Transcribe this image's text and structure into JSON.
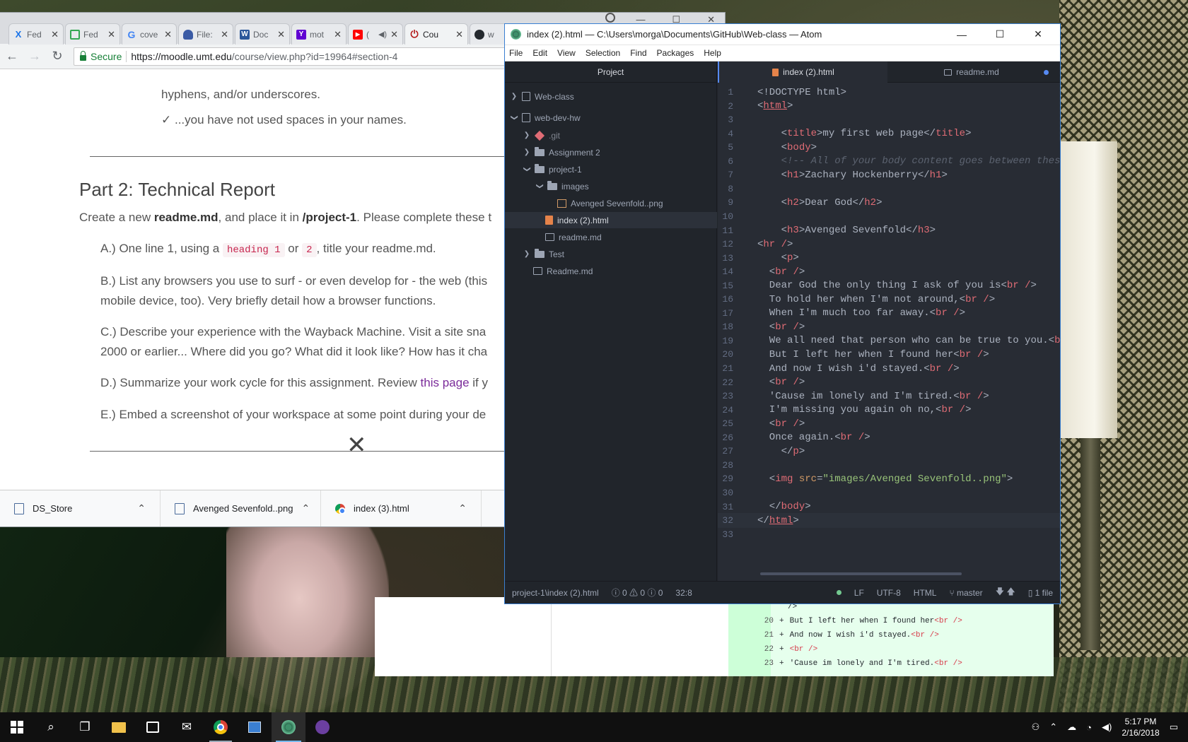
{
  "chrome": {
    "tabs": [
      {
        "label": "Fed",
        "icon": "x-logo-icon",
        "color": "#1a73e8"
      },
      {
        "label": "Fed",
        "icon": "document-icon",
        "color": "#34a853"
      },
      {
        "label": "cove",
        "icon": "google-icon",
        "color": "#4285f4"
      },
      {
        "label": "File:",
        "icon": "cloud-icon",
        "color": "#3b5ba5"
      },
      {
        "label": "Doc",
        "icon": "word-icon",
        "color": "#2b579a"
      },
      {
        "label": "mot",
        "icon": "yahoo-icon",
        "color": "#6001d2"
      },
      {
        "label": "(",
        "icon": "youtube-icon",
        "color": "#ff0000"
      },
      {
        "label": "Cou",
        "icon": "power-icon",
        "color": "#b31b1b"
      },
      {
        "label": "w",
        "icon": "github-icon",
        "color": "#24292e"
      }
    ],
    "url": {
      "secure": "Secure",
      "main": "https://moodle.umt.edu",
      "path": "/course/view.php?id=19964#section-4"
    },
    "page": {
      "line1": "hyphens, and/or underscores.",
      "line2": "✓ ...you have not used spaces in your names.",
      "heading": "Part 2: Technical Report",
      "intro_a": "Create a new ",
      "intro_b": "readme.md",
      "intro_c": ", and place it in ",
      "intro_d": "/project-1",
      "intro_e": ". Please complete these t",
      "a_pre": "A.) One line 1, using a ",
      "a_code1": "heading 1",
      "a_or": " or ",
      "a_code2": "2",
      "a_post": ", title your readme.md.",
      "b1": "B.) List any browsers you use to surf - or even develop for - the web (this",
      "b2": "mobile device, too). Very briefly detail how a browser functions.",
      "c1": "C.) Describe your experience with the Wayback Machine. Visit a site sna",
      "c2": "2000 or earlier... Where did you go? What did it look like? How has it cha",
      "d_pre": "D.) Summarize your work cycle for this assignment. Review ",
      "d_link": "this page",
      "d_post": " if y",
      "e": "E.) Embed a screenshot of your workspace at some point during your de"
    },
    "downloads": [
      {
        "name": "DS_Store"
      },
      {
        "name": "Avenged Sevenfold..png"
      },
      {
        "name": "index (3).html"
      }
    ]
  },
  "diff": {
    "rows": [
      {
        "num": "",
        "text": "/>"
      },
      {
        "num": "20",
        "text": "But I left her when I found her",
        "tag": "<br />"
      },
      {
        "num": "21",
        "text": "And now I wish i'd stayed.",
        "tag": "<br />"
      },
      {
        "num": "22",
        "text": "",
        "tag": "<br />"
      },
      {
        "num": "23",
        "text": "'Cause im lonely and I'm tired.",
        "tag": "<br />"
      }
    ]
  },
  "atom": {
    "title": "index (2).html — C:\\Users\\morga\\Documents\\GitHub\\Web-class — Atom",
    "menu": [
      "File",
      "Edit",
      "View",
      "Selection",
      "Find",
      "Packages",
      "Help"
    ],
    "tree_header": "Project",
    "tree": [
      {
        "label": "Web-class"
      },
      {
        "label": "web-dev-hw"
      },
      {
        "label": ".git"
      },
      {
        "label": "Assignment 2"
      },
      {
        "label": "project-1"
      },
      {
        "label": "images"
      },
      {
        "label": "Avenged Sevenfold..png"
      },
      {
        "label": "index (2).html"
      },
      {
        "label": "readme.md"
      },
      {
        "label": "Test"
      },
      {
        "label": "Readme.md"
      }
    ],
    "tabs": [
      {
        "label": "index (2).html"
      },
      {
        "label": "readme.md"
      }
    ],
    "status": {
      "path": "project-1\\index (2).html",
      "diagnostics": "ⓘ 0 ⚠ 0 ⓘ 0",
      "cursor": "32:8",
      "line_ending": "LF",
      "encoding": "UTF-8",
      "grammar": "HTML",
      "branch": "master",
      "files": "1 file"
    }
  },
  "code_lines": [
    "<!DOCTYPE html>",
    "<html>",
    "",
    "    <title>my first web page</title>",
    "    <body>",
    "    <!-- All of your body content goes between thes",
    "    <h1>Zachary Hockenberry</h1>",
    "",
    "    <h2>Dear God</h2>",
    "",
    "    <h3>Avenged Sevenfold</h3>",
    "<hr />",
    "    <p>",
    "  <br />",
    "  Dear God the only thing I ask of you is<br />",
    "  To hold her when I'm not around,<br />",
    "  When I'm much too far away.<br />",
    "  <br />",
    "  We all need that person who can be true to you.<b",
    "  But I left her when I found her<br />",
    "  And now I wish i'd stayed.<br />",
    "  <br />",
    "  'Cause im lonely and I'm tired.<br />",
    "  I'm missing you again oh no,<br />",
    "  <br />",
    "  Once again.<br />",
    "    </p>",
    "",
    "  <img src=\"images/Avenged Sevenfold..png\">",
    "",
    "  </body>",
    "</html>",
    ""
  ],
  "taskbar": {
    "time": "5:17 PM",
    "date": "2/16/2018"
  }
}
